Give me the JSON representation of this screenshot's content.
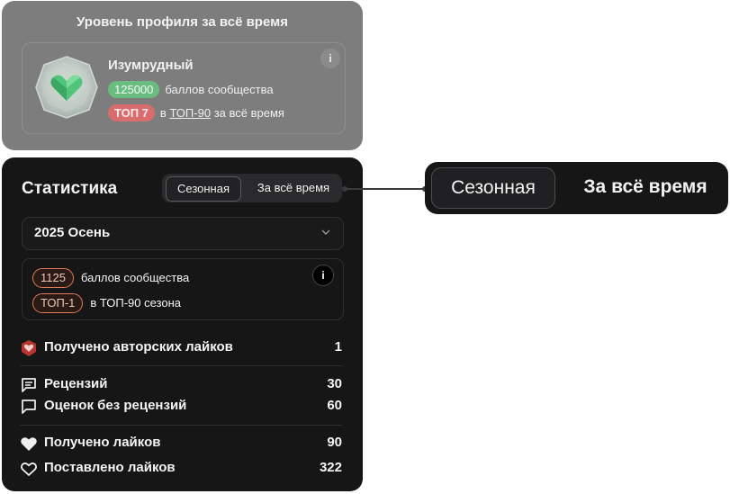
{
  "level_card": {
    "title": "Уровень профиля за всё время",
    "level_name": "Изумрудный",
    "points": "125000",
    "points_label": "баллов сообщества",
    "top_rank": "ТОП 7",
    "top_prefix": "в",
    "top_link": "ТОП-90",
    "top_suffix": "за всё время",
    "info_icon": "i",
    "badge_icon": "emerald-heart-gem-icon"
  },
  "stats_card": {
    "title": "Статистика",
    "toggle": {
      "season": "Сезонная",
      "all_time": "За всё время"
    },
    "season_select": "2025 Осень",
    "season_points": "1125",
    "season_points_label": "баллов сообщества",
    "season_rank": "ТОП-1",
    "season_rank_label": "в ТОП-90 сезона",
    "info_icon": "i",
    "rows": [
      {
        "icon": "heart-shield-icon",
        "label": "Получено авторских лайков",
        "value": "1"
      },
      {
        "icon": "review-icon",
        "label": "Рецензий",
        "value": "30"
      },
      {
        "icon": "comment-icon",
        "label": "Оценок без рецензий",
        "value": "60"
      },
      {
        "icon": "heart-filled-icon",
        "label": "Получено лайков",
        "value": "90"
      },
      {
        "icon": "heart-outline-icon",
        "label": "Поставлено лайков",
        "value": "322"
      }
    ]
  },
  "zoom_toggle": {
    "season": "Сезонная",
    "all_time": "За всё время"
  },
  "colors": {
    "accent_green": "#6bbd7f",
    "accent_red": "#d96d6d",
    "accent_orange": "#e0785a",
    "panel_dark": "#161617"
  }
}
